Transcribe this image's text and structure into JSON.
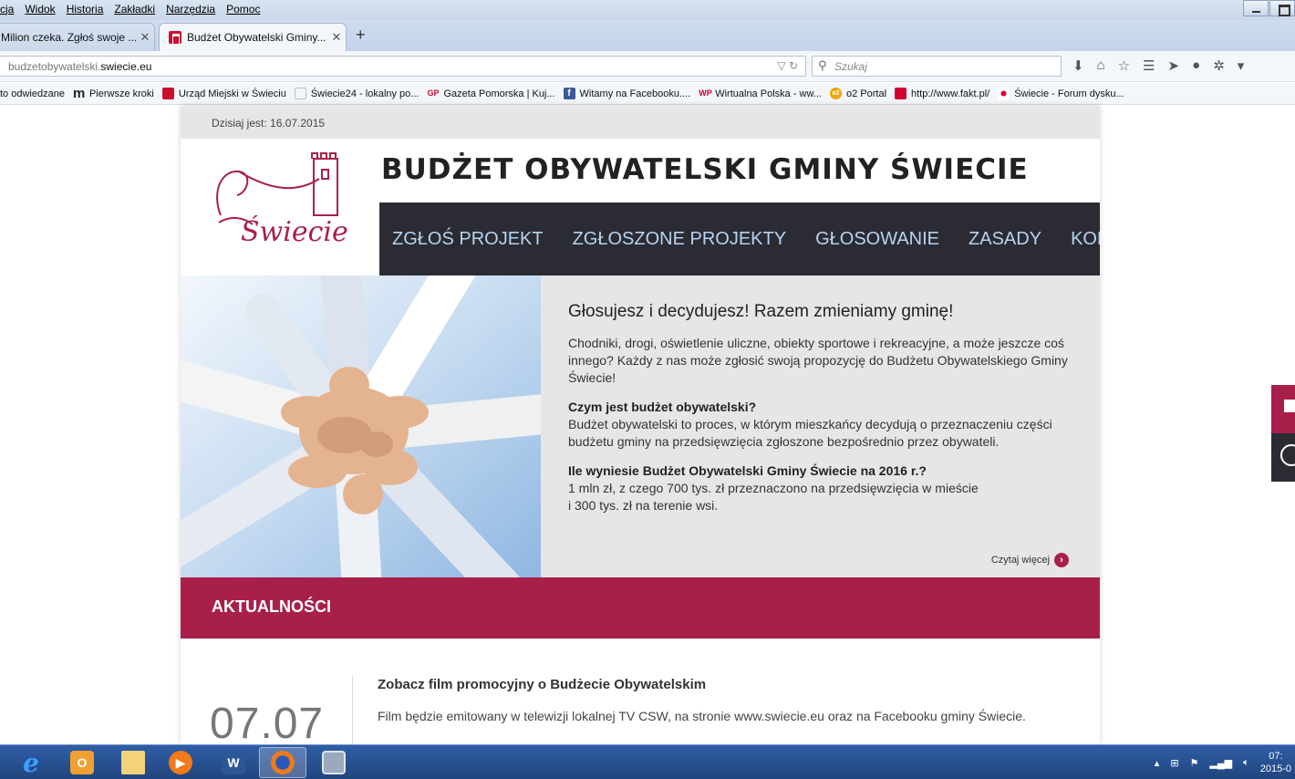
{
  "browser": {
    "menu": [
      "ycja",
      "Widok",
      "Historia",
      "Zakładki",
      "Narzędzia",
      "Pomoc"
    ],
    "tabs": [
      {
        "title": "Milion czeka. Zgłoś swoje ...",
        "close": "✕"
      },
      {
        "title": "Budżet Obywatelski Gminy...",
        "close": "✕"
      }
    ],
    "newtab": "+",
    "url_prefix": "budzetobywatelski.",
    "url_domain": "swiecie.eu",
    "search_placeholder": "Szukaj",
    "bookmarks": [
      {
        "label": "to odwiedzane",
        "icon": ""
      },
      {
        "label": "Pierwsze kroki",
        "icon": "m"
      },
      {
        "label": "Urząd Miejski w Świeciu",
        "icon": "swiecie-crest-icon"
      },
      {
        "label": "Świecie24 - lokalny po...",
        "icon": "blank-page-icon"
      },
      {
        "label": "Gazeta Pomorska | Kuj...",
        "icon": "GP"
      },
      {
        "label": "Witamy na Facebooku....",
        "icon": "f"
      },
      {
        "label": "Wirtualna Polska - ww...",
        "icon": "WP"
      },
      {
        "label": "o2 Portal",
        "icon": "o2"
      },
      {
        "label": "http://www.fakt.pl/",
        "icon": "fakt-icon"
      },
      {
        "label": "Świecie - Forum dysku...",
        "icon": "forum-icon"
      }
    ]
  },
  "site": {
    "date_text": "Dzisiaj jest: 16.07.2015",
    "title": "BUDŻET OBYWATELSKI GMINY ŚWIECIE",
    "logo_text": "Świecie",
    "nav": [
      "ZGŁOŚ PROJEKT",
      "ZGŁOSZONE PROJEKTY",
      "GŁOSOWANIE",
      "ZASADY",
      "KONTAKT"
    ],
    "hero": {
      "heading": "Głosujesz i decydujesz! Razem zmieniamy gminę!",
      "intro": "Chodniki, drogi, oświetlenie uliczne, obiekty sportowe i rekreacyjne, a może jeszcze coś innego? Każdy z nas może zgłosić swoją propozycję do Budżetu Obywatelskiego Gminy Świecie!",
      "q1": "Czym jest budżet obywatelski?",
      "a1": "Budżet obywatelski to proces, w którym mieszkańcy decydują o przeznaczeniu części budżetu gminy na przedsięwzięcia zgłoszone bezpośrednio przez obywateli.",
      "q2": "Ile wyniesie Budżet Obywatelski Gminy Świecie na 2016 r.?",
      "a2_line1": "1 mln zł, z czego 700 tys. zł przeznaczono na przedsięwzięcia w mieście",
      "a2_line2": "i 300 tys. zł na terenie wsi.",
      "read_more": "Czytaj więcej"
    },
    "news_heading": "AKTUALNOŚCI",
    "news": [
      {
        "date": "07.07",
        "title": "Zobacz film promocyjny o Budżecie Obywatelskim",
        "body": "Film będzie emitowany w telewizji lokalnej TV CSW, na stronie www.swiecie.eu oraz na Facebooku gminy Świecie."
      }
    ]
  },
  "taskbar": {
    "apps": [
      "internet-explorer-icon",
      "outlook-icon",
      "file-explorer-icon",
      "media-player-icon",
      "word-icon",
      "firefox-icon",
      "calculator-icon"
    ],
    "clock_time": "07:",
    "clock_date": "2015-0"
  },
  "colors": {
    "accent": "#a8204a",
    "nav_bg": "#2b2b33",
    "nav_text": "#b7d3f0"
  }
}
